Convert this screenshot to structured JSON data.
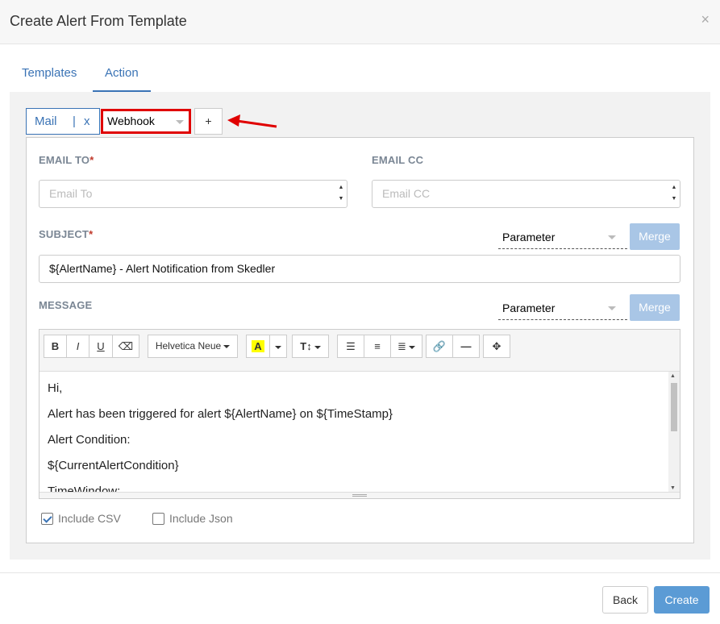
{
  "dialog": {
    "title": "Create Alert From Template",
    "close": "×"
  },
  "tabs": [
    {
      "label": "Templates"
    },
    {
      "label": "Action"
    }
  ],
  "channels": {
    "mail_chip": {
      "label": "Mail",
      "sep": "|",
      "remove": "x"
    },
    "selected_type": "Webhook",
    "add_label": "+"
  },
  "form": {
    "email_to": {
      "label": "EMAIL TO",
      "required": "*",
      "placeholder": "Email To"
    },
    "email_cc": {
      "label": "EMAIL CC",
      "placeholder": "Email CC"
    },
    "subject": {
      "label": "SUBJECT",
      "required": "*",
      "parameter": "Parameter",
      "merge": "Merge",
      "value": "${AlertName} - Alert Notification from Skedler"
    },
    "message": {
      "label": "MESSAGE",
      "parameter": "Parameter",
      "merge": "Merge",
      "toolbar": {
        "bold": "B",
        "italic": "I",
        "underline": "U",
        "font": "Helvetica Neue",
        "highlight": "A",
        "size": "T↕"
      },
      "lines": [
        "Hi,",
        "Alert has been triggered for alert ${AlertName} on ${TimeStamp}",
        "Alert Condition:",
        "${CurrentAlertCondition}",
        "TimeWindow:"
      ]
    },
    "include_csv": {
      "label": "Include CSV",
      "checked": true
    },
    "include_json": {
      "label": "Include Json",
      "checked": false
    }
  },
  "footer": {
    "back": "Back",
    "create": "Create"
  },
  "colors": {
    "accent": "#3a73b5",
    "highlight_box": "#e00000",
    "primary_button": "#5b9bd5"
  }
}
